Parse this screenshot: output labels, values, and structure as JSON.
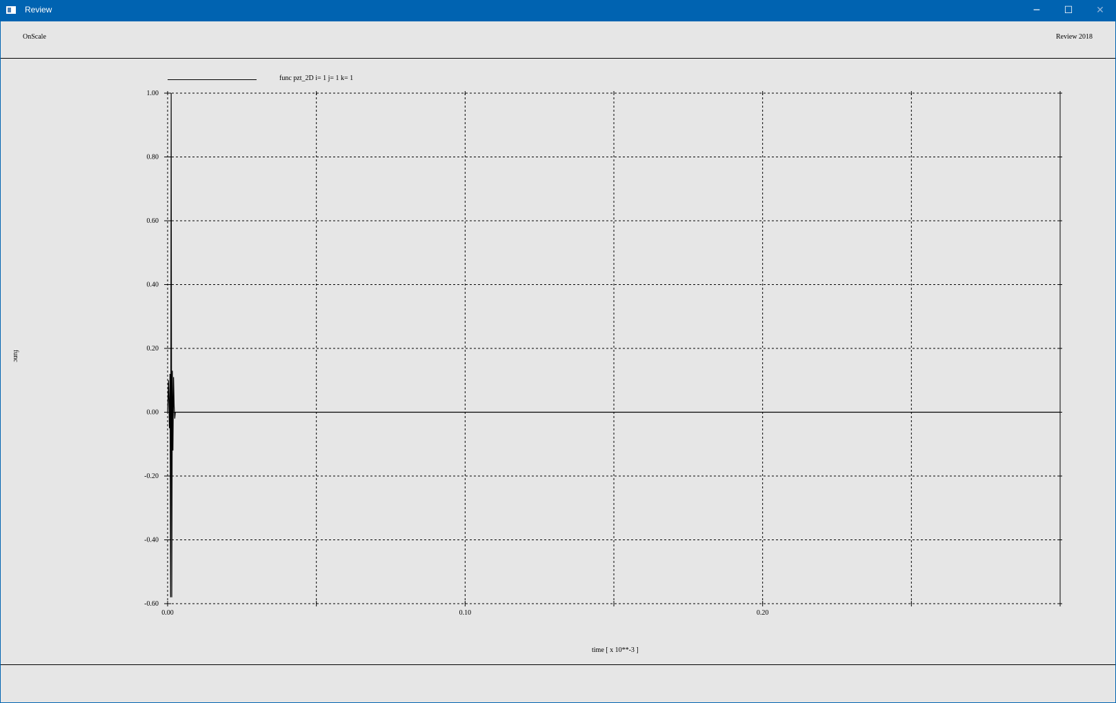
{
  "window": {
    "title": "Review",
    "minimize_glyph": "─",
    "maximize_glyph": "☐",
    "close_glyph": "✕"
  },
  "header": {
    "left_label": "OnScale",
    "right_label": "Review 2018"
  },
  "chart_data": {
    "type": "line",
    "legend": "func pzt_2D i= 1 j= 1 k= 1",
    "xlabel": "time [ x 10**-3 ]",
    "ylabel": "func",
    "xlim": [
      0.0,
      0.3
    ],
    "ylim": [
      -0.6,
      1.0
    ],
    "xticks": [
      0.0,
      0.05,
      0.1,
      0.15,
      0.2,
      0.25,
      0.3
    ],
    "xtick_labels": [
      "0.00",
      "",
      "0.10",
      "",
      "0.20",
      "",
      ""
    ],
    "yticks": [
      -0.6,
      -0.4,
      -0.2,
      0.0,
      0.2,
      0.4,
      0.6,
      0.8,
      1.0
    ],
    "ytick_labels": [
      "-0.60",
      "-0.40",
      "-0.20",
      "0.00",
      "0.20",
      "0.40",
      "0.60",
      "0.80",
      "1.00"
    ],
    "grid": true,
    "series": [
      {
        "name": "func pzt_2D i= 1 j= 1 k= 1",
        "x": [
          0.0,
          0.0003,
          0.0006,
          0.0008,
          0.001,
          0.0012,
          0.0014,
          0.0016,
          0.0018,
          0.002,
          0.0022,
          0.0024,
          0.0026,
          0.0028,
          0.003,
          0.0032,
          0.0034,
          0.0036,
          0.3
        ],
        "y": [
          0.0,
          0.1,
          -0.05,
          0.12,
          -0.58,
          1.0,
          -0.58,
          0.13,
          -0.12,
          0.11,
          0.02,
          -0.02,
          0.0,
          0.0,
          0.0,
          0.0,
          0.0,
          0.0,
          0.0
        ]
      }
    ],
    "axis_color": "#000000",
    "grid_color": "#000000"
  }
}
